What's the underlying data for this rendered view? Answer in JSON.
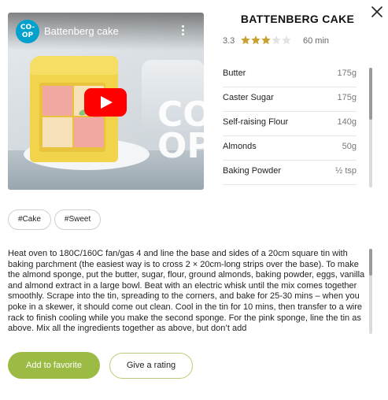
{
  "video": {
    "title": "Battenberg cake",
    "channel_logo_text": "CO-OP",
    "overlay_text": "CO OP"
  },
  "recipe": {
    "title": "BATTENBERG CAKE",
    "rating": "3.3",
    "stars_filled": 3,
    "stars_total": 5,
    "duration": "60 min"
  },
  "ingredients": [
    {
      "name": "Butter",
      "amount": "175g"
    },
    {
      "name": "Caster Sugar",
      "amount": "175g"
    },
    {
      "name": "Self-raising Flour",
      "amount": "140g"
    },
    {
      "name": "Almonds",
      "amount": "50g"
    },
    {
      "name": "Baking Powder",
      "amount": "½ tsp"
    }
  ],
  "tags": [
    "#Cake",
    "#Sweet"
  ],
  "description": "Heat oven to 180C/160C fan/gas 4 and line the base and sides of a 20cm square tin with baking parchment (the easiest way is to cross 2 × 20cm-long strips over the base). To make the almond sponge, put the butter, sugar, flour, ground almonds, baking powder, eggs, vanilla and almond extract in a large bowl. Beat with an electric whisk until the mix comes together smoothly. Scrape into the tin, spreading to the corners, and bake for 25-30 mins – when you poke in a skewer, it should come out clean. Cool in the tin for 10 mins, then transfer to a wire rack to finish cooling while you make the second sponge. For the pink sponge, line the tin as above. Mix all the ingredients together as above, but don’t add",
  "actions": {
    "favorite_label": "Add to favorite",
    "rate_label": "Give a rating"
  },
  "colors": {
    "accent_green": "#9bbb45",
    "star_gold": "#c8a12e",
    "star_empty": "#e3e3e3",
    "youtube_red": "#ff0000"
  }
}
